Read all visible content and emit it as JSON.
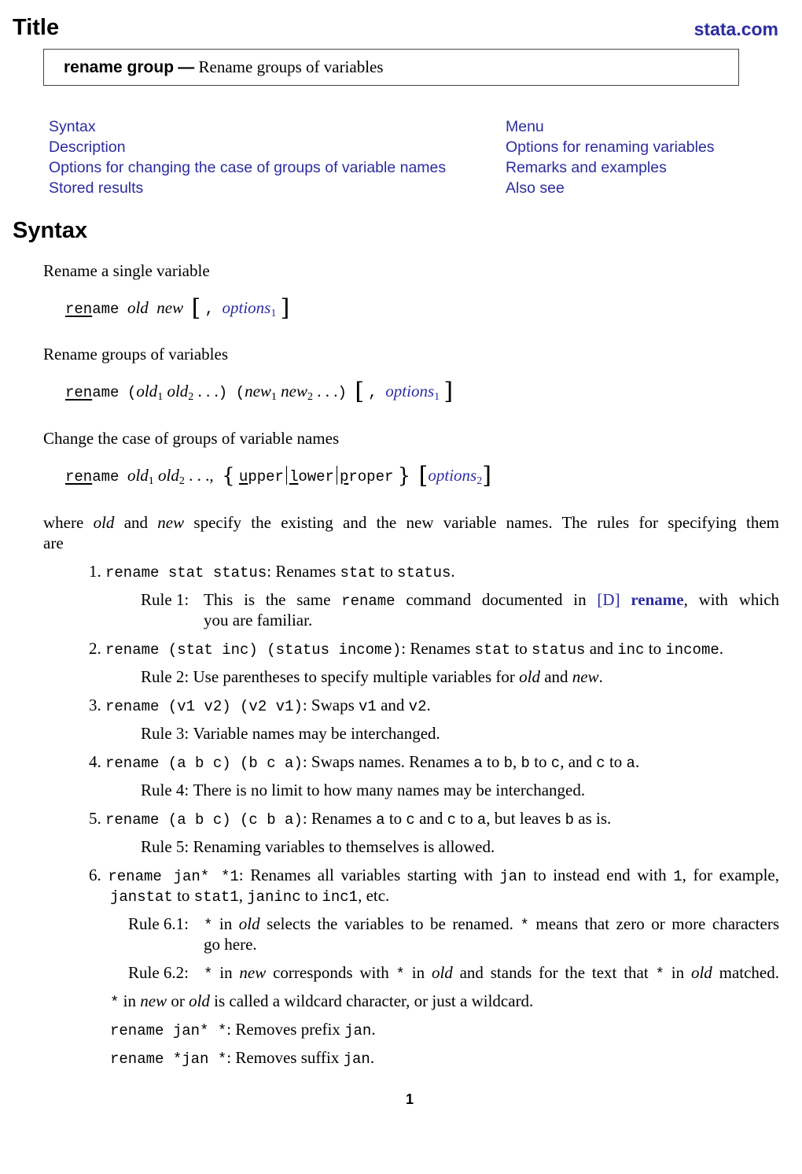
{
  "header": {
    "title": "Title",
    "site": "stata.com"
  },
  "title_box": {
    "command": "rename group",
    "dash": "—",
    "description": "Rename groups of variables"
  },
  "toc": {
    "left": [
      "Syntax",
      "Description",
      "Options for changing the case of groups of variable names",
      "Stored results"
    ],
    "right": [
      "Menu",
      "Options for renaming variables",
      "Remarks and examples",
      "Also see"
    ]
  },
  "syntax": {
    "heading": "Syntax",
    "forms": [
      {
        "caption": "Rename a single variable",
        "cmd_abbrev": "ren",
        "cmd_rest": "ame",
        "args_old": "old",
        "args_new": "new",
        "comma": ",",
        "options": "options",
        "options_sub": "1"
      },
      {
        "caption": "Rename groups of variables",
        "cmd_abbrev": "ren",
        "cmd_rest": "ame",
        "old": "old",
        "new": "new",
        "sub1": "1",
        "sub2": "2",
        "ellipsis": ". . .",
        "lparen": "(",
        "rparen": ")",
        "comma": ",",
        "options": "options",
        "options_sub": "1"
      },
      {
        "caption": "Change the case of groups of variable names",
        "cmd_abbrev": "ren",
        "cmd_rest": "ame",
        "old": "old",
        "sub1": "1",
        "sub2": "2",
        "ellipsis": ". . .,",
        "upper_abbrev": "u",
        "upper_rest": "pper",
        "lower_abbrev": "l",
        "lower_rest": "ower",
        "proper_abbrev": "p",
        "proper_rest": "roper",
        "options": "options",
        "options_sub": "2"
      }
    ],
    "where_text": {
      "p1": "where ",
      "old": "old",
      "p2": " and ",
      "new": "new",
      "p3": " specify the existing and the new variable names. The rules for specifying them",
      "p4": "are"
    },
    "rules": {
      "r1_num": "1.",
      "r1_cmd": "rename stat status",
      "r1_a": ": Renames ",
      "r1_b": "stat",
      "r1_c": " to ",
      "r1_d": "status",
      "r1_e": ".",
      "rule1_label": "Rule 1:",
      "rule1_a": "This is the same ",
      "rule1_cmd": "rename",
      "rule1_b": " command documented in ",
      "rule1_ref": "[D]",
      "rule1_link": "rename",
      "rule1_c": ", with which",
      "rule1_d": "you are familiar.",
      "r2_num": "2.",
      "r2_cmd": "rename (stat inc) (status income)",
      "r2_a": ": Renames ",
      "r2_b": "stat",
      "r2_c": " to ",
      "r2_d": "status",
      "r2_e": " and ",
      "r2_f": "inc",
      "r2_g": " to ",
      "r2_h": "income",
      "r2_i": ".",
      "rule2_label": "Rule 2:",
      "rule2_a": "Use parentheses to specify multiple variables for ",
      "rule2_old": "old",
      "rule2_b": " and ",
      "rule2_new": "new",
      "rule2_c": ".",
      "r3_num": "3.",
      "r3_cmd": "rename (v1 v2) (v2 v1)",
      "r3_a": ": Swaps ",
      "r3_b": "v1",
      "r3_c": " and ",
      "r3_d": "v2",
      "r3_e": ".",
      "rule3_label": "Rule 3:",
      "rule3_text": "Variable names may be interchanged.",
      "r4_num": "4.",
      "r4_cmd": "rename (a b c) (b c a)",
      "r4_a": ": Swaps names. Renames ",
      "r4_v1": "a",
      "r4_t1": " to ",
      "r4_v2": "b",
      "r4_t2": ", ",
      "r4_v3": "b",
      "r4_t3": " to ",
      "r4_v4": "c",
      "r4_t4": ", and ",
      "r4_v5": "c",
      "r4_t5": " to ",
      "r4_v6": "a",
      "r4_t6": ".",
      "rule4_label": "Rule 4:",
      "rule4_text": "There is no limit to how many names may be interchanged.",
      "r5_num": "5.",
      "r5_cmd": "rename (a b c) (c b a)",
      "r5_a": ": Renames ",
      "r5_v1": "a",
      "r5_t1": " to ",
      "r5_v2": "c",
      "r5_t2": " and ",
      "r5_v3": "c",
      "r5_t3": " to ",
      "r5_v4": "a",
      "r5_t4": ", but leaves ",
      "r5_v5": "b",
      "r5_t5": " as is.",
      "rule5_label": "Rule 5:",
      "rule5_text": "Renaming variables to themselves is allowed.",
      "r6_num": "6.",
      "r6_cmd": "rename jan* *1",
      "r6_a": ": Renames all variables starting with ",
      "r6_b": "jan",
      "r6_c": " to instead end with ",
      "r6_d": "1",
      "r6_e": ", for example,",
      "r6_f": "janstat",
      "r6_g": " to ",
      "r6_h": "stat1",
      "r6_i": ", ",
      "r6_j": "janinc",
      "r6_k": " to ",
      "r6_l": "inc1",
      "r6_m": ", etc.",
      "rule61_label": "Rule 6.1:",
      "rule61_star": "*",
      "rule61_a": " in ",
      "rule61_old": "old",
      "rule61_b": " selects the variables to be renamed. ",
      "rule61_star2": "*",
      "rule61_c": " means that zero or more characters",
      "rule61_d": "go here.",
      "rule62_label": "Rule 6.2:",
      "rule62_star": "*",
      "rule62_a": " in ",
      "rule62_new": "new",
      "rule62_b": " corresponds with ",
      "rule62_star2": "*",
      "rule62_c": " in ",
      "rule62_old": "old",
      "rule62_d": " and stands for the text that ",
      "rule62_star3": "*",
      "rule62_e": " in ",
      "rule62_old2": "old",
      "rule62_f": " matched.",
      "wild_star": "*",
      "wild_a": " in ",
      "wild_new": "new",
      "wild_b": " or ",
      "wild_old": "old",
      "wild_c": " is called a wildcard character, or just a wildcard.",
      "ex1_cmd": "rename jan* *",
      "ex1_a": ": Removes prefix ",
      "ex1_b": "jan",
      "ex1_c": ".",
      "ex2_cmd": "rename *jan *",
      "ex2_a": ": Removes suffix ",
      "ex2_b": "jan",
      "ex2_c": "."
    }
  },
  "footer": {
    "page_number": "1"
  }
}
